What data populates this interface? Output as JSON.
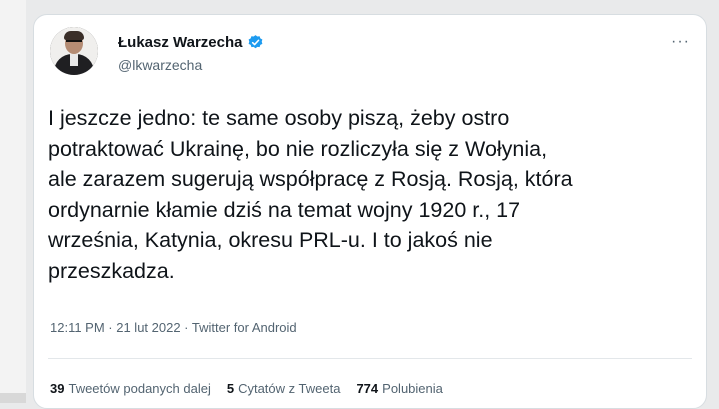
{
  "tweet": {
    "author": {
      "display_name": "Łukasz Warzecha",
      "handle": "@lkwarzecha",
      "verified": true
    },
    "more_icon": "more-options-icon",
    "text": "I jeszcze jedno: te same osoby piszą, żeby ostro\npotraktować Ukrainę, bo nie rozliczyła się z Wołynia,\nale zarazem sugerują współpracę z Rosją. Rosją, która\nordynarnie kłamie dziś na temat wojny 1920 r., 17\nwrześnia, Katynia, okresu PRL-u. I to jakoś nie\nprzeszkadza.",
    "meta": "12:11 PM · 21 lut 2022 · Twitter for Android",
    "stats": [
      {
        "count": "39",
        "label": "Tweetów podanych dalej"
      },
      {
        "count": "5",
        "label": "Cytatów z Tweeta"
      },
      {
        "count": "774",
        "label": "Polubienia"
      }
    ]
  },
  "colors": {
    "text": "#0f1419",
    "secondary": "#536471",
    "verified": "#1d9bf0",
    "border": "#d7dde1"
  }
}
